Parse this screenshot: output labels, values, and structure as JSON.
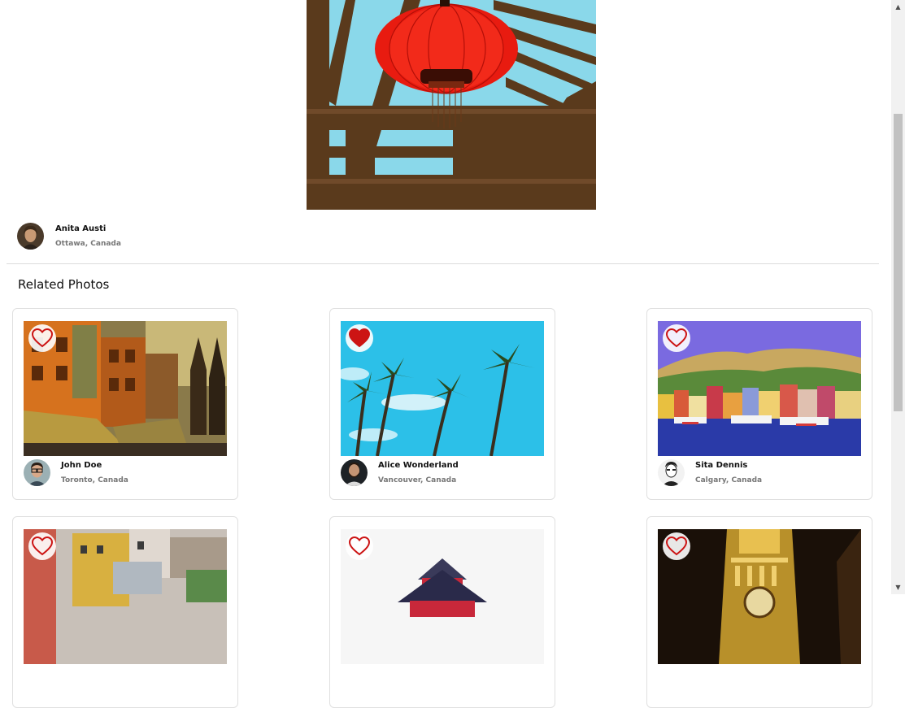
{
  "main_photo": {
    "icon": "red-lantern-photo",
    "author": {
      "name": "Anita Austi",
      "location": "Ottawa, Canada",
      "avatar_icon": "woman-avatar"
    }
  },
  "section": {
    "title": "Related Photos"
  },
  "related": [
    {
      "photo_icon": "colorful-street-photo",
      "liked": false,
      "name": "John Doe",
      "location": "Toronto, Canada",
      "avatar_icon": "man-glasses-avatar"
    },
    {
      "photo_icon": "palm-trees-photo",
      "liked": true,
      "name": "Alice Wonderland",
      "location": "Vancouver, Canada",
      "avatar_icon": "man-beard-avatar"
    },
    {
      "photo_icon": "harbor-town-photo",
      "liked": false,
      "name": "Sita Dennis",
      "location": "Calgary, Canada",
      "avatar_icon": "man-sketch-avatar"
    },
    {
      "photo_icon": "hillside-houses-photo",
      "liked": false
    },
    {
      "photo_icon": "pagoda-photo",
      "liked": false
    },
    {
      "photo_icon": "clock-tower-photo",
      "liked": false
    }
  ],
  "colors": {
    "heart": "#cc1414",
    "divider": "#dcdcdc",
    "muted_text": "#777777"
  },
  "scrollbar": {
    "up_icon": "▲",
    "down_icon": "▼"
  }
}
